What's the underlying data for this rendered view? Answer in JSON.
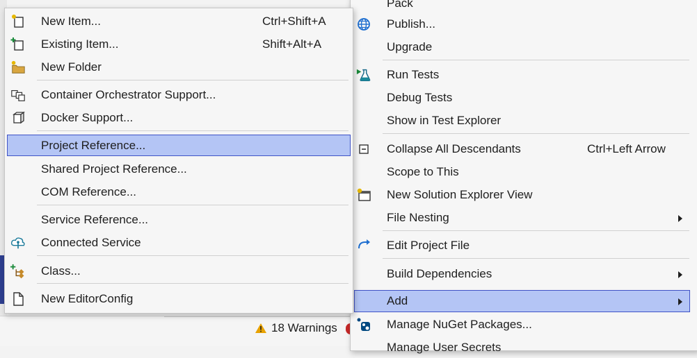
{
  "status": {
    "warnings": "18 Warnings"
  },
  "left_menu": {
    "items": [
      {
        "label": "New Item...",
        "shortcut": "Ctrl+Shift+A",
        "icon": "new-item-icon"
      },
      {
        "label": "Existing Item...",
        "shortcut": "Shift+Alt+A",
        "icon": "existing-item-icon"
      },
      {
        "label": "New Folder",
        "shortcut": "",
        "icon": "new-folder-icon"
      },
      {
        "label": "Container Orchestrator Support...",
        "shortcut": "",
        "icon": "container-orchestrator-icon"
      },
      {
        "label": "Docker Support...",
        "shortcut": "",
        "icon": "docker-icon"
      },
      {
        "label": "Project Reference...",
        "shortcut": "",
        "icon": ""
      },
      {
        "label": "Shared Project Reference...",
        "shortcut": "",
        "icon": ""
      },
      {
        "label": "COM Reference...",
        "shortcut": "",
        "icon": ""
      },
      {
        "label": "Service Reference...",
        "shortcut": "",
        "icon": ""
      },
      {
        "label": "Connected Service",
        "shortcut": "",
        "icon": "connected-service-icon"
      },
      {
        "label": "Class...",
        "shortcut": "",
        "icon": "class-icon"
      },
      {
        "label": "New EditorConfig",
        "shortcut": "",
        "icon": "editorconfig-icon"
      }
    ],
    "selected": "Project Reference..."
  },
  "right_menu": {
    "items": [
      {
        "label": "Pack",
        "shortcut": "",
        "icon": ""
      },
      {
        "label": "Publish...",
        "shortcut": "",
        "icon": "publish-globe-icon"
      },
      {
        "label": "Upgrade",
        "shortcut": "",
        "icon": ""
      },
      {
        "label": "Run Tests",
        "shortcut": "",
        "icon": "run-tests-icon"
      },
      {
        "label": "Debug Tests",
        "shortcut": "",
        "icon": ""
      },
      {
        "label": "Show in Test Explorer",
        "shortcut": "",
        "icon": ""
      },
      {
        "label": "Collapse All Descendants",
        "shortcut": "Ctrl+Left Arrow",
        "icon": "collapse-icon"
      },
      {
        "label": "Scope to This",
        "shortcut": "",
        "icon": ""
      },
      {
        "label": "New Solution Explorer View",
        "shortcut": "",
        "icon": "new-view-icon"
      },
      {
        "label": "File Nesting",
        "shortcut": "",
        "icon": ""
      },
      {
        "label": "Edit Project File",
        "shortcut": "",
        "icon": "edit-project-icon"
      },
      {
        "label": "Build Dependencies",
        "shortcut": "",
        "icon": ""
      },
      {
        "label": "Add",
        "shortcut": "",
        "icon": ""
      },
      {
        "label": "Manage NuGet Packages...",
        "shortcut": "",
        "icon": "nuget-icon"
      },
      {
        "label": "Manage User Secrets",
        "shortcut": "",
        "icon": ""
      }
    ],
    "selected": "Add"
  },
  "colors": {
    "highlight": "#b4c5f5",
    "highlight_border": "#3f52c6",
    "warning": "#e8a200"
  }
}
